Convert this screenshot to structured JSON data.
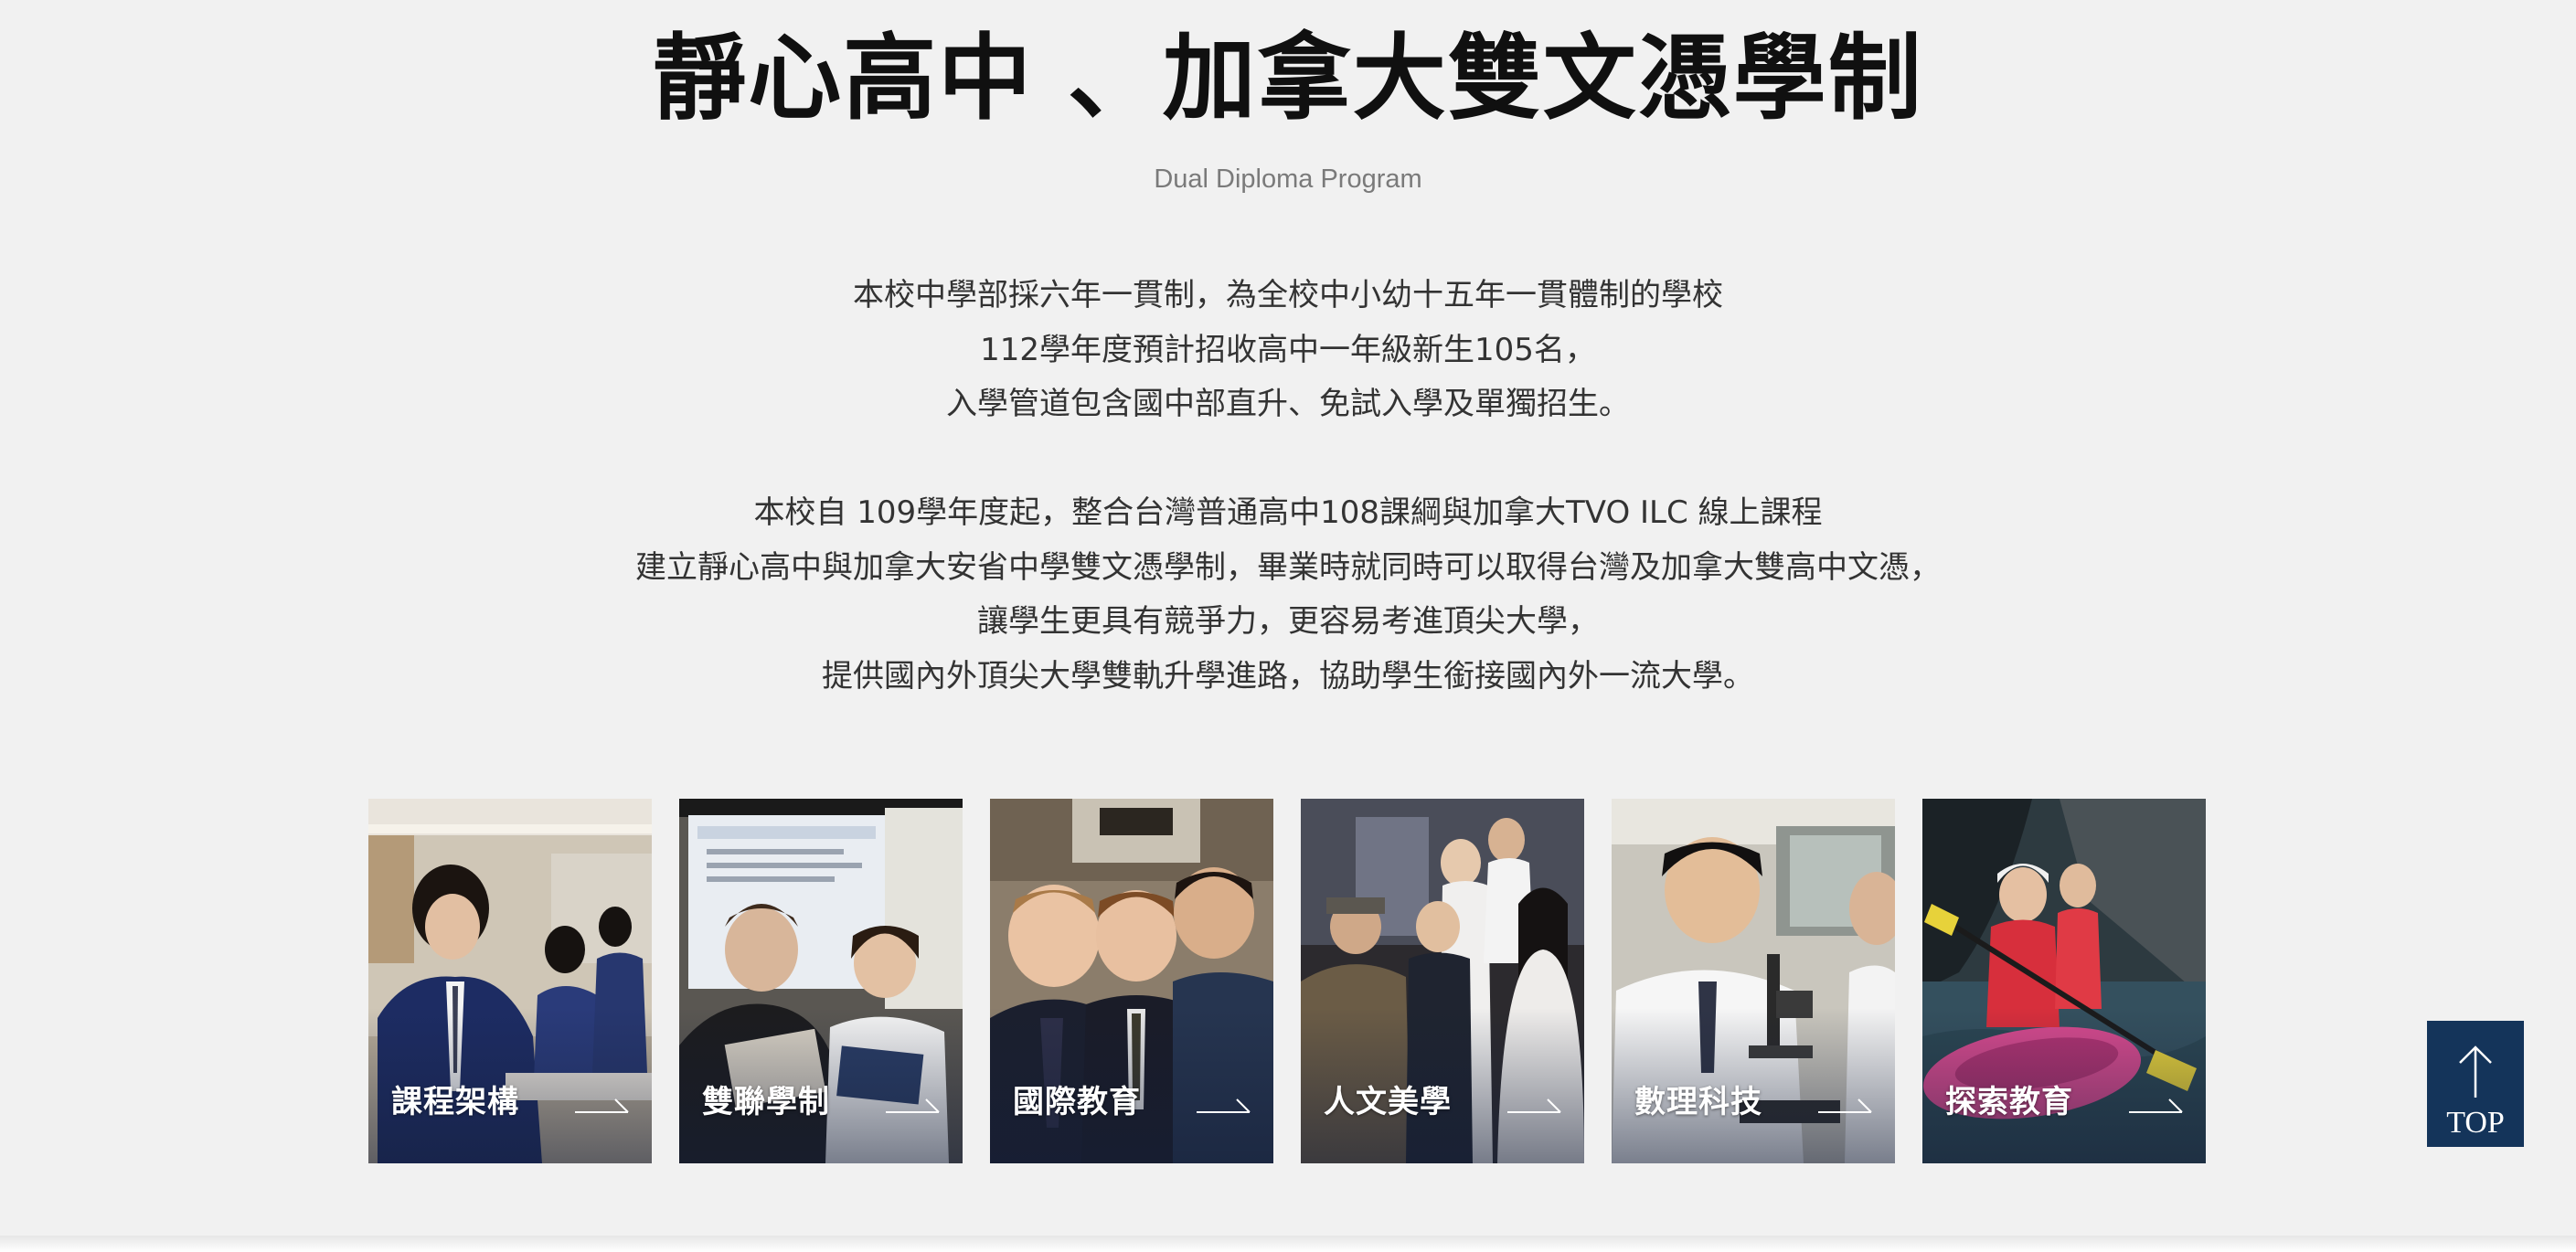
{
  "heading": {
    "title": "靜心高中 、加拿大雙文憑學制",
    "subtitle": "Dual Diploma Program"
  },
  "intro": {
    "paragraph_1": [
      "本校中學部採六年一貫制，為全校中小幼十五年一貫體制的學校",
      "112學年度預計招收高中一年級新生105名，",
      "入學管道包含國中部直升、免試入學及單獨招生。"
    ],
    "paragraph_2": [
      "本校自 109學年度起，整合台灣普通高中108課綱與加拿大TVO ILC 線上課程",
      "建立靜心高中與加拿大安省中學雙文憑學制，畢業時就同時可以取得台灣及加拿大雙高中文憑，",
      "讓學生更具有競爭力，更容易考進頂尖大學，",
      "提供國內外頂尖大學雙軌升學進路，協助學生銜接國內外一流大學。"
    ]
  },
  "cards": [
    {
      "label": "課程架構",
      "icon": "arrow-right-icon"
    },
    {
      "label": "雙聯學制",
      "icon": "arrow-right-icon"
    },
    {
      "label": "國際教育",
      "icon": "arrow-right-icon"
    },
    {
      "label": "人文美學",
      "icon": "arrow-right-icon"
    },
    {
      "label": "數理科技",
      "icon": "arrow-right-icon"
    },
    {
      "label": "探索教育",
      "icon": "arrow-right-icon"
    }
  ],
  "back_to_top": {
    "label": "TOP",
    "icon": "arrow-up-icon",
    "color": "#14345a"
  }
}
